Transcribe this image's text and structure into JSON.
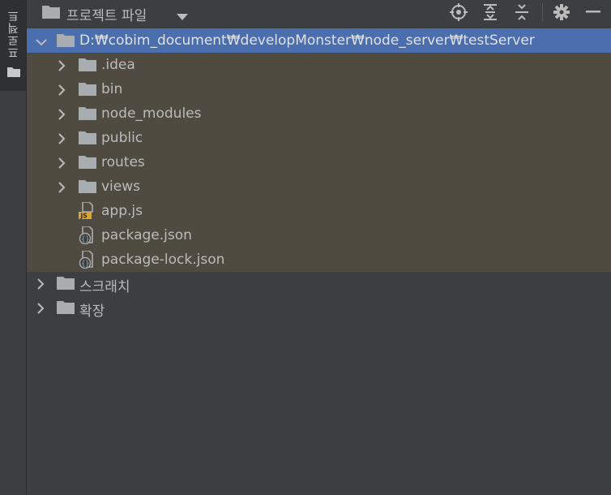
{
  "sidebar": {
    "tab_label": "프로젝트"
  },
  "header": {
    "title": "프로젝트 파일"
  },
  "tree": {
    "root": {
      "label": "D:₩cobim_document₩developMonster₩node_server₩testServer"
    },
    "children": [
      {
        "label": ".idea",
        "kind": "folder"
      },
      {
        "label": "bin",
        "kind": "folder"
      },
      {
        "label": "node_modules",
        "kind": "folder"
      },
      {
        "label": "public",
        "kind": "folder"
      },
      {
        "label": "routes",
        "kind": "folder"
      },
      {
        "label": "views",
        "kind": "folder"
      },
      {
        "label": "app.js",
        "kind": "js-file"
      },
      {
        "label": "package.json",
        "kind": "json-file"
      },
      {
        "label": "package-lock.json",
        "kind": "json-file"
      }
    ],
    "scratches": {
      "label": "스크래치"
    },
    "extensions": {
      "label": "확장"
    }
  },
  "colors": {
    "background": "#3c3f41",
    "selection": "#4b6eaf",
    "project_highlight": "#4f4b41",
    "folder_icon": "#a8adb2",
    "js_badge": "#d9a634"
  }
}
